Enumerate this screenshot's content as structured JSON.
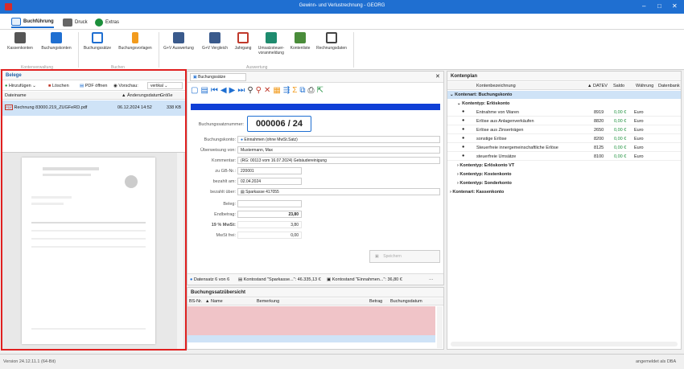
{
  "title": "Gewinn- und Verlustrechnung - GEORG",
  "window_controls": [
    "–",
    "□",
    "✕"
  ],
  "menu": {
    "tabs": [
      {
        "label": "Buchführung",
        "active": true
      },
      {
        "label": "Druck"
      },
      {
        "label": "Extras"
      }
    ]
  },
  "ribbon": {
    "buttons": [
      "Kassenkonten",
      "Buchungskonten",
      "Buchungssätze",
      "Buchungsvorlagen",
      "G+V Auswertung",
      "G+V Vergleich",
      "Jahrgang",
      "Umsatzsteuer-voranmeldung",
      "Kontenliste",
      "Rechnungsdaten"
    ],
    "groups": [
      "Kontenverwaltung",
      "Buchen",
      "Auswertung"
    ]
  },
  "belege": {
    "title": "Belege",
    "toolbar": {
      "add": "Hinzufügen",
      "delete": "Löschen",
      "pdf": "PDF öffnen",
      "preview": "Vorschau:",
      "mode": "vertikal"
    },
    "columns": [
      "Dateiname",
      "Änderungsdatum",
      "Größe"
    ],
    "file": {
      "name": "Rechnung 83000.219_ZUGFeRD.pdf",
      "date": "06.12.2024 14:52",
      "size": "338 KB"
    }
  },
  "buchung": {
    "tab": "Buchungssätze",
    "number_label": "Buchungssatznummer:",
    "number": "000006 / 24",
    "fields": [
      {
        "label": "Buchungskonto:",
        "value": "Einnahmen (ohne MwSt.Satz)"
      },
      {
        "label": "Überweisung von:",
        "value": "Mustermann, Max"
      },
      {
        "label": "Kommentar:",
        "value": "(RG: 00113 vom 16.07.2024) Gebäudereinigung"
      },
      {
        "label": "zu GB-Nr.:",
        "value": "220001"
      },
      {
        "label": "bezahlt am:",
        "value": "02.04.2024"
      },
      {
        "label": "bezahlt über:",
        "value": "Sparkasse 417055"
      },
      {
        "label": "Beleg:",
        "value": ""
      },
      {
        "label": "Endbetrag:",
        "value": "23,80"
      },
      {
        "label": "19 % MwSt:",
        "value": "3,80"
      },
      {
        "label": "MwSt frei:",
        "value": "0,00"
      }
    ],
    "save": "Speichern",
    "status": [
      "Datensatz 6 von 6",
      "Kontostand \"Sparkasse...\": 46.335,13 €",
      "Kontostand \"Einnahmen...\": 36,80 €"
    ]
  },
  "uebersicht": {
    "title": "Buchungssatzübersicht",
    "columns": [
      "BS-Nr.",
      "Name",
      "Bemerkung",
      "Betrag",
      "Buchungsdatum"
    ]
  },
  "kontenplan": {
    "title": "Kontenplan",
    "columns": [
      "Kontenbezeichnung",
      "DATEV",
      "Saldo",
      "Währung",
      "Datenbank"
    ],
    "tree": [
      {
        "label": "Kontenart: Buchungskonto",
        "level": 0,
        "open": true
      },
      {
        "label": "Kontentyp: Erlöskonto",
        "level": 1,
        "open": true
      },
      {
        "label": "Entnahme von Waren",
        "datev": "8919",
        "saldo": "0,00 €",
        "cur": "Euro",
        "level": 2
      },
      {
        "label": "Erlöse aus Anlagenverkäufen",
        "datev": "8820",
        "saldo": "0,00 €",
        "cur": "Euro",
        "level": 2
      },
      {
        "label": "Erlöse aus Zinserträgen",
        "datev": "2650",
        "saldo": "0,00 €",
        "cur": "Euro",
        "level": 2
      },
      {
        "label": "sonstige Erlöse",
        "datev": "8200",
        "saldo": "0,00 €",
        "cur": "Euro",
        "level": 2
      },
      {
        "label": "Steuerfreie innergemeinschaftliche Erlöse",
        "datev": "8125",
        "saldo": "0,00 €",
        "cur": "Euro",
        "level": 2
      },
      {
        "label": "steuerfreie Umsätze",
        "datev": "8100",
        "saldo": "0,00 €",
        "cur": "Euro",
        "level": 2
      },
      {
        "label": "Kontentyp: Erlöskonto VT",
        "level": 1
      },
      {
        "label": "Kontentyp: Kostenkonto",
        "level": 1
      },
      {
        "label": "Kontentyp: Sonderkonto",
        "level": 1
      },
      {
        "label": "Kontenart: Kassenkonto",
        "level": 0
      }
    ]
  },
  "status": {
    "version": "Version 24.12.11.1 (64-Bit)",
    "user": "angemeldet als DBA"
  }
}
